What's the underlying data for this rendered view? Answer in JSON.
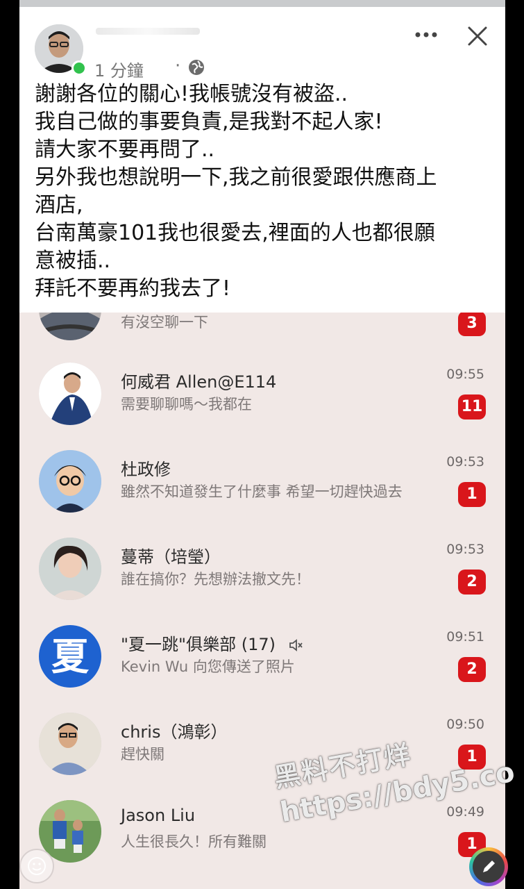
{
  "post": {
    "time": "1 分鐘",
    "separator": "·",
    "lines": [
      "謝謝各位的關心!我帳號沒有被盜..",
      "我自己做的事要負責,是我對不起人家!",
      "請大家不要再問了..",
      "另外我也想說明一下,我之前很愛跟供應商上",
      "酒店,",
      "台南萬豪101我也很愛去,裡面的人也都很願",
      "意被插..",
      "拜託不要再約我去了!"
    ]
  },
  "chats": [
    {
      "name": "",
      "message": "有沒空聊一下",
      "time": "",
      "badge": "3"
    },
    {
      "name": "何威君 Allen@E114",
      "message": "需要聊聊嗎～我都在",
      "time": "09:55",
      "badge": "11"
    },
    {
      "name": "杜政修",
      "message": "雖然不知道發生了什麼事 希望一切趕快過去",
      "time": "09:53",
      "badge": "1"
    },
    {
      "name": "蔓蒂（培瑩）",
      "message": "誰在搞你？先想辦法撤文先！",
      "time": "09:53",
      "badge": "2"
    },
    {
      "name": "\"夏一跳\"俱樂部 (17)",
      "message": "Kevin Wu 向您傳送了照片",
      "time": "09:51",
      "badge": "2",
      "avatar_char": "夏"
    },
    {
      "name": "chris（鴻彰）",
      "message": "趕快關",
      "time": "09:50",
      "badge": "1"
    },
    {
      "name": "Jason Liu",
      "message": "人生很長久！所有難關",
      "time": "09:49",
      "badge": "1"
    }
  ],
  "watermark": {
    "line1": "黑料不打烊",
    "line2": "https://bdy5.co"
  },
  "colors": {
    "badge": "#d9161b",
    "online": "#31c24d",
    "group_avatar": "#1e62d0"
  }
}
